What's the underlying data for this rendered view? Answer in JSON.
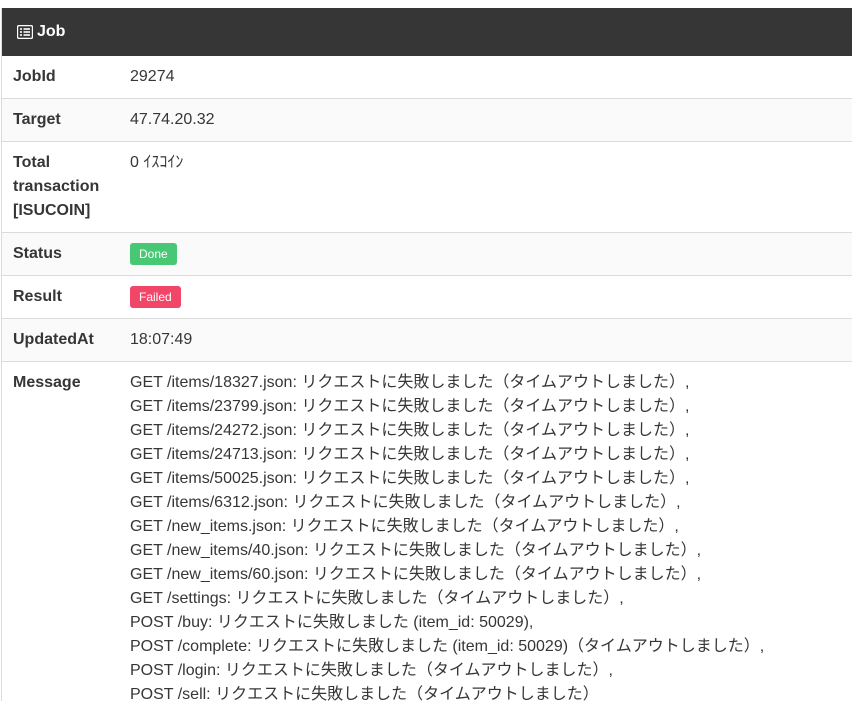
{
  "header": {
    "title": "Job",
    "icon": "list-icon"
  },
  "rows": {
    "jobid": {
      "label": "JobId",
      "value": "29274"
    },
    "target": {
      "label": "Target",
      "value": "47.74.20.32"
    },
    "total": {
      "label": "Total transaction [ISUCOIN]",
      "value": "0 ｲｽｺｲﾝ"
    },
    "status": {
      "label": "Status",
      "value": "Done",
      "color": "#48c774"
    },
    "result": {
      "label": "Result",
      "value": "Failed",
      "color": "#f14668"
    },
    "updated": {
      "label": "UpdatedAt",
      "value": "18:07:49"
    },
    "message": {
      "label": "Message",
      "lines": [
        "GET /items/18327.json: リクエストに失敗しました（タイムアウトしました）,",
        "GET /items/23799.json: リクエストに失敗しました（タイムアウトしました）,",
        "GET /items/24272.json: リクエストに失敗しました（タイムアウトしました）,",
        "GET /items/24713.json: リクエストに失敗しました（タイムアウトしました）,",
        "GET /items/50025.json: リクエストに失敗しました（タイムアウトしました）,",
        "GET /items/6312.json: リクエストに失敗しました（タイムアウトしました）,",
        "GET /new_items.json: リクエストに失敗しました（タイムアウトしました）,",
        "GET /new_items/40.json: リクエストに失敗しました（タイムアウトしました）,",
        "GET /new_items/60.json: リクエストに失敗しました（タイムアウトしました）,",
        "GET /settings: リクエストに失敗しました（タイムアウトしました）,",
        "POST /buy: リクエストに失敗しました (item_id: 50029),",
        "POST /complete: リクエストに失敗しました (item_id: 50029)（タイムアウトしました）,",
        "POST /login: リクエストに失敗しました（タイムアウトしました）,",
        "POST /sell: リクエストに失敗しました（タイムアウトしました）"
      ]
    }
  }
}
